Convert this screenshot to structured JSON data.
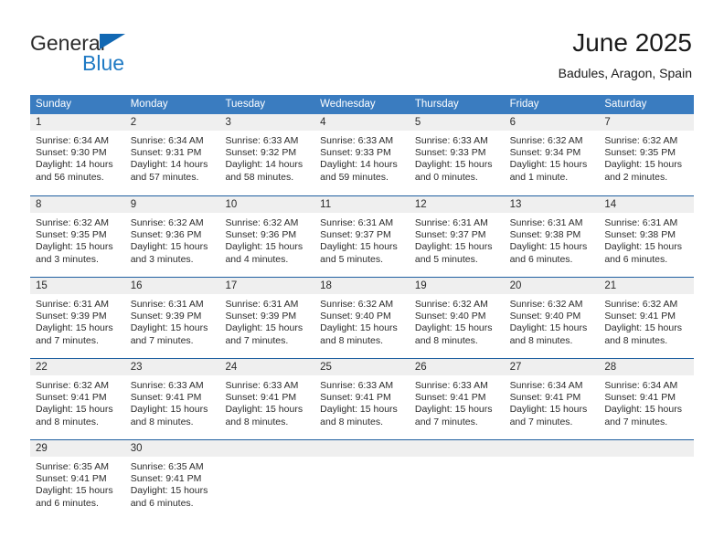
{
  "brand": {
    "name_part1": "General",
    "name_part2": "Blue",
    "triangle_icon": "triangle-icon",
    "accent_color": "#1f7ac4"
  },
  "header": {
    "title": "June 2025",
    "subtitle": "Badules, Aragon, Spain"
  },
  "colors": {
    "header_blue": "#3a7cc0",
    "rule_blue": "#1f5fa0",
    "day_band_gray": "#efefef",
    "text": "#2b2b2b"
  },
  "weekdays": [
    "Sunday",
    "Monday",
    "Tuesday",
    "Wednesday",
    "Thursday",
    "Friday",
    "Saturday"
  ],
  "weeks": [
    {
      "days": [
        {
          "num": "1",
          "sunrise": "Sunrise: 6:34 AM",
          "sunset": "Sunset: 9:30 PM",
          "daylight1": "Daylight: 14 hours",
          "daylight2": "and 56 minutes."
        },
        {
          "num": "2",
          "sunrise": "Sunrise: 6:34 AM",
          "sunset": "Sunset: 9:31 PM",
          "daylight1": "Daylight: 14 hours",
          "daylight2": "and 57 minutes."
        },
        {
          "num": "3",
          "sunrise": "Sunrise: 6:33 AM",
          "sunset": "Sunset: 9:32 PM",
          "daylight1": "Daylight: 14 hours",
          "daylight2": "and 58 minutes."
        },
        {
          "num": "4",
          "sunrise": "Sunrise: 6:33 AM",
          "sunset": "Sunset: 9:33 PM",
          "daylight1": "Daylight: 14 hours",
          "daylight2": "and 59 minutes."
        },
        {
          "num": "5",
          "sunrise": "Sunrise: 6:33 AM",
          "sunset": "Sunset: 9:33 PM",
          "daylight1": "Daylight: 15 hours",
          "daylight2": "and 0 minutes."
        },
        {
          "num": "6",
          "sunrise": "Sunrise: 6:32 AM",
          "sunset": "Sunset: 9:34 PM",
          "daylight1": "Daylight: 15 hours",
          "daylight2": "and 1 minute."
        },
        {
          "num": "7",
          "sunrise": "Sunrise: 6:32 AM",
          "sunset": "Sunset: 9:35 PM",
          "daylight1": "Daylight: 15 hours",
          "daylight2": "and 2 minutes."
        }
      ]
    },
    {
      "days": [
        {
          "num": "8",
          "sunrise": "Sunrise: 6:32 AM",
          "sunset": "Sunset: 9:35 PM",
          "daylight1": "Daylight: 15 hours",
          "daylight2": "and 3 minutes."
        },
        {
          "num": "9",
          "sunrise": "Sunrise: 6:32 AM",
          "sunset": "Sunset: 9:36 PM",
          "daylight1": "Daylight: 15 hours",
          "daylight2": "and 3 minutes."
        },
        {
          "num": "10",
          "sunrise": "Sunrise: 6:32 AM",
          "sunset": "Sunset: 9:36 PM",
          "daylight1": "Daylight: 15 hours",
          "daylight2": "and 4 minutes."
        },
        {
          "num": "11",
          "sunrise": "Sunrise: 6:31 AM",
          "sunset": "Sunset: 9:37 PM",
          "daylight1": "Daylight: 15 hours",
          "daylight2": "and 5 minutes."
        },
        {
          "num": "12",
          "sunrise": "Sunrise: 6:31 AM",
          "sunset": "Sunset: 9:37 PM",
          "daylight1": "Daylight: 15 hours",
          "daylight2": "and 5 minutes."
        },
        {
          "num": "13",
          "sunrise": "Sunrise: 6:31 AM",
          "sunset": "Sunset: 9:38 PM",
          "daylight1": "Daylight: 15 hours",
          "daylight2": "and 6 minutes."
        },
        {
          "num": "14",
          "sunrise": "Sunrise: 6:31 AM",
          "sunset": "Sunset: 9:38 PM",
          "daylight1": "Daylight: 15 hours",
          "daylight2": "and 6 minutes."
        }
      ]
    },
    {
      "days": [
        {
          "num": "15",
          "sunrise": "Sunrise: 6:31 AM",
          "sunset": "Sunset: 9:39 PM",
          "daylight1": "Daylight: 15 hours",
          "daylight2": "and 7 minutes."
        },
        {
          "num": "16",
          "sunrise": "Sunrise: 6:31 AM",
          "sunset": "Sunset: 9:39 PM",
          "daylight1": "Daylight: 15 hours",
          "daylight2": "and 7 minutes."
        },
        {
          "num": "17",
          "sunrise": "Sunrise: 6:31 AM",
          "sunset": "Sunset: 9:39 PM",
          "daylight1": "Daylight: 15 hours",
          "daylight2": "and 7 minutes."
        },
        {
          "num": "18",
          "sunrise": "Sunrise: 6:32 AM",
          "sunset": "Sunset: 9:40 PM",
          "daylight1": "Daylight: 15 hours",
          "daylight2": "and 8 minutes."
        },
        {
          "num": "19",
          "sunrise": "Sunrise: 6:32 AM",
          "sunset": "Sunset: 9:40 PM",
          "daylight1": "Daylight: 15 hours",
          "daylight2": "and 8 minutes."
        },
        {
          "num": "20",
          "sunrise": "Sunrise: 6:32 AM",
          "sunset": "Sunset: 9:40 PM",
          "daylight1": "Daylight: 15 hours",
          "daylight2": "and 8 minutes."
        },
        {
          "num": "21",
          "sunrise": "Sunrise: 6:32 AM",
          "sunset": "Sunset: 9:41 PM",
          "daylight1": "Daylight: 15 hours",
          "daylight2": "and 8 minutes."
        }
      ]
    },
    {
      "days": [
        {
          "num": "22",
          "sunrise": "Sunrise: 6:32 AM",
          "sunset": "Sunset: 9:41 PM",
          "daylight1": "Daylight: 15 hours",
          "daylight2": "and 8 minutes."
        },
        {
          "num": "23",
          "sunrise": "Sunrise: 6:33 AM",
          "sunset": "Sunset: 9:41 PM",
          "daylight1": "Daylight: 15 hours",
          "daylight2": "and 8 minutes."
        },
        {
          "num": "24",
          "sunrise": "Sunrise: 6:33 AM",
          "sunset": "Sunset: 9:41 PM",
          "daylight1": "Daylight: 15 hours",
          "daylight2": "and 8 minutes."
        },
        {
          "num": "25",
          "sunrise": "Sunrise: 6:33 AM",
          "sunset": "Sunset: 9:41 PM",
          "daylight1": "Daylight: 15 hours",
          "daylight2": "and 8 minutes."
        },
        {
          "num": "26",
          "sunrise": "Sunrise: 6:33 AM",
          "sunset": "Sunset: 9:41 PM",
          "daylight1": "Daylight: 15 hours",
          "daylight2": "and 7 minutes."
        },
        {
          "num": "27",
          "sunrise": "Sunrise: 6:34 AM",
          "sunset": "Sunset: 9:41 PM",
          "daylight1": "Daylight: 15 hours",
          "daylight2": "and 7 minutes."
        },
        {
          "num": "28",
          "sunrise": "Sunrise: 6:34 AM",
          "sunset": "Sunset: 9:41 PM",
          "daylight1": "Daylight: 15 hours",
          "daylight2": "and 7 minutes."
        }
      ]
    },
    {
      "days": [
        {
          "num": "29",
          "sunrise": "Sunrise: 6:35 AM",
          "sunset": "Sunset: 9:41 PM",
          "daylight1": "Daylight: 15 hours",
          "daylight2": "and 6 minutes."
        },
        {
          "num": "30",
          "sunrise": "Sunrise: 6:35 AM",
          "sunset": "Sunset: 9:41 PM",
          "daylight1": "Daylight: 15 hours",
          "daylight2": "and 6 minutes."
        },
        {
          "num": "",
          "sunrise": "",
          "sunset": "",
          "daylight1": "",
          "daylight2": ""
        },
        {
          "num": "",
          "sunrise": "",
          "sunset": "",
          "daylight1": "",
          "daylight2": ""
        },
        {
          "num": "",
          "sunrise": "",
          "sunset": "",
          "daylight1": "",
          "daylight2": ""
        },
        {
          "num": "",
          "sunrise": "",
          "sunset": "",
          "daylight1": "",
          "daylight2": ""
        },
        {
          "num": "",
          "sunrise": "",
          "sunset": "",
          "daylight1": "",
          "daylight2": ""
        }
      ]
    }
  ]
}
